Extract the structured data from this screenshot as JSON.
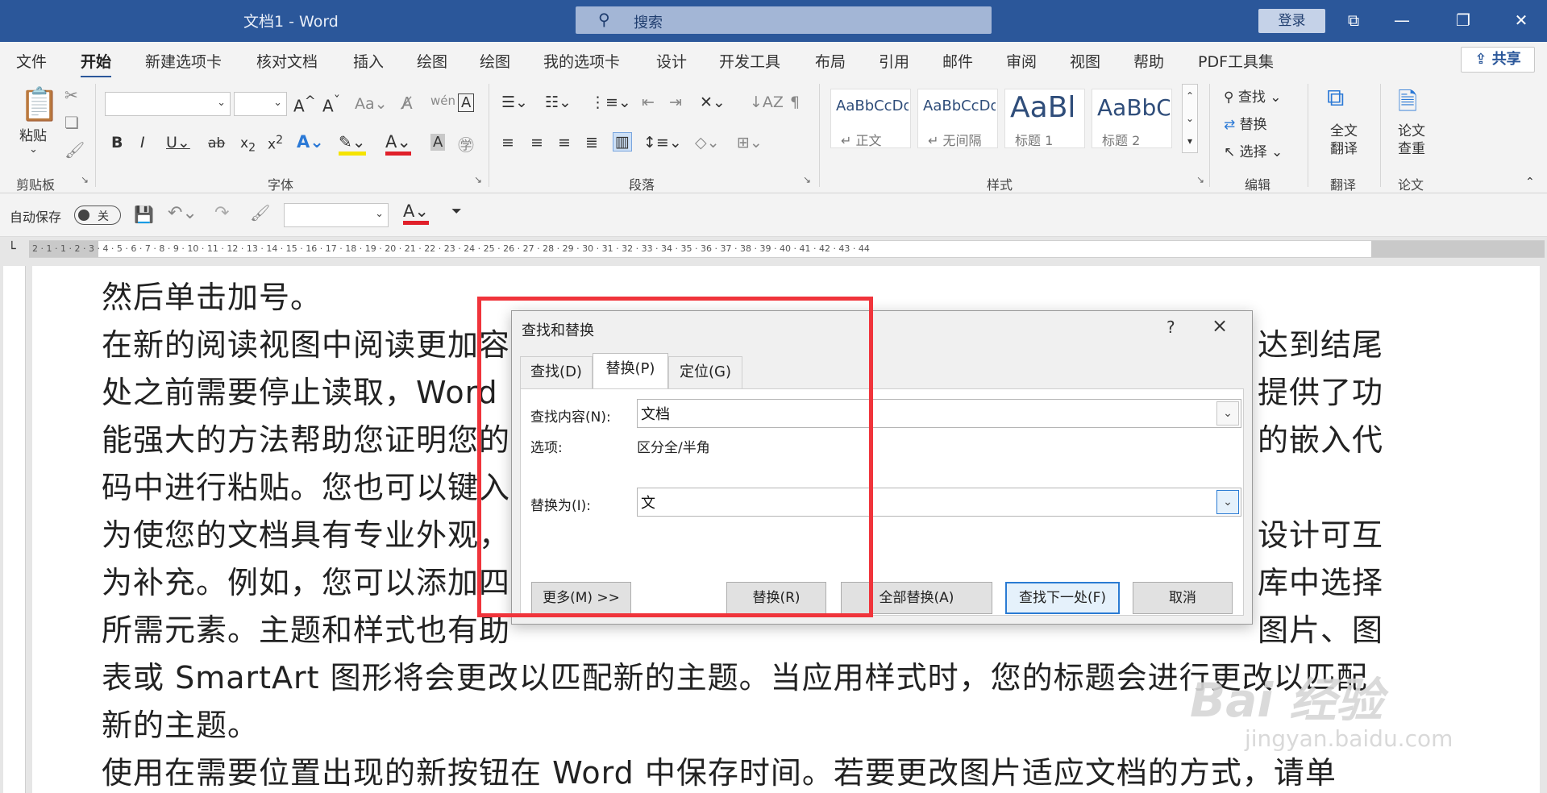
{
  "window": {
    "title": "文档1 - Word",
    "search_placeholder": "搜索",
    "login_label": "登录"
  },
  "menu": {
    "tabs": [
      "文件",
      "开始",
      "新建选项卡",
      "核对文档",
      "插入",
      "绘图",
      "绘图",
      "我的选项卡",
      "设计",
      "开发工具",
      "布局",
      "引用",
      "邮件",
      "审阅",
      "视图",
      "帮助",
      "PDF工具集"
    ],
    "active": "开始",
    "share_label": "共享"
  },
  "ribbon": {
    "groups": {
      "clipboard": "剪贴板",
      "font": "字体",
      "paragraph": "段落",
      "styles": "样式",
      "editing": "编辑",
      "translate": "翻译",
      "paper": "论文"
    },
    "paste_label": "粘贴",
    "styles": [
      {
        "sample": "AaBbCcDd",
        "name": "↵ 正文"
      },
      {
        "sample": "AaBbCcDd",
        "name": "↵ 无间隔"
      },
      {
        "sample": "AaBl",
        "name": "标题 1"
      },
      {
        "sample": "AaBbC",
        "name": "标题 2"
      }
    ],
    "editing": {
      "find": "查找",
      "replace": "替换",
      "select": "选择"
    },
    "translate_label": "全文\n翻译",
    "paper_label": "论文\n查重"
  },
  "qat": {
    "autosave_label": "自动保存",
    "autosave_state": "关"
  },
  "ruler_numbers": "2 · 1 · 1 · 2 · 3 · 4 · 5 · 6 · 7 · 8 · 9 · 10 · 11 · 12 · 13 · 14 · 15 · 16 · 17 · 18 · 19 · 20 · 21 · 22 · 23 · 24 · 25 · 26 · 27 · 28 · 29 · 30 · 31 · 32 · 33 · 34 · 35 · 36 · 37 · 38 · 39 · 40 · 41 · 42 · 43 · 44",
  "document": {
    "lines": [
      "然后单击加号。",
      "在新的阅读视图中阅读更加容",
      "处之前需要停止读取，Word",
      "能强大的方法帮助您证明您的",
      "码中进行粘贴。您也可以键入",
      "为使您的文档具有专业外观，",
      "为补充。例如，您可以添加四",
      "所需元素。主题和样式也有助",
      "表或 SmartArt 图形将会更改以匹配新的主题。当应用样式时，您的标题会进行更改以匹配",
      "新的主题。",
      "使用在需要位置出现的新按钮在 Word 中保存时间。若要更改图片适应文档的方式，请单"
    ],
    "right_fragments": [
      "达到结尾",
      "提供了功",
      "的嵌入代",
      "设计可互",
      "库中选择",
      "图片、图"
    ]
  },
  "dialog": {
    "title": "查找和替换",
    "help": "?",
    "close": "×",
    "tabs": [
      "查找(D)",
      "替换(P)",
      "定位(G)"
    ],
    "active_tab": "替换(P)",
    "find_label": "查找内容(N):",
    "find_value": "文档",
    "options_label": "选项:",
    "options_value": "区分全/半角",
    "replace_label": "替换为(I):",
    "replace_value": "文",
    "buttons": {
      "more": "更多(M) >>",
      "replace": "替换(R)",
      "replace_all": "全部替换(A)",
      "find_next": "查找下一处(F)",
      "cancel": "取消"
    }
  },
  "watermark": {
    "text": "Bai 经验",
    "url": "jingyan.baidu.com"
  },
  "colors": {
    "title_bar": "#2b579a",
    "highlight_box": "#f0343b",
    "focus_blue": "#2a7bd3"
  }
}
